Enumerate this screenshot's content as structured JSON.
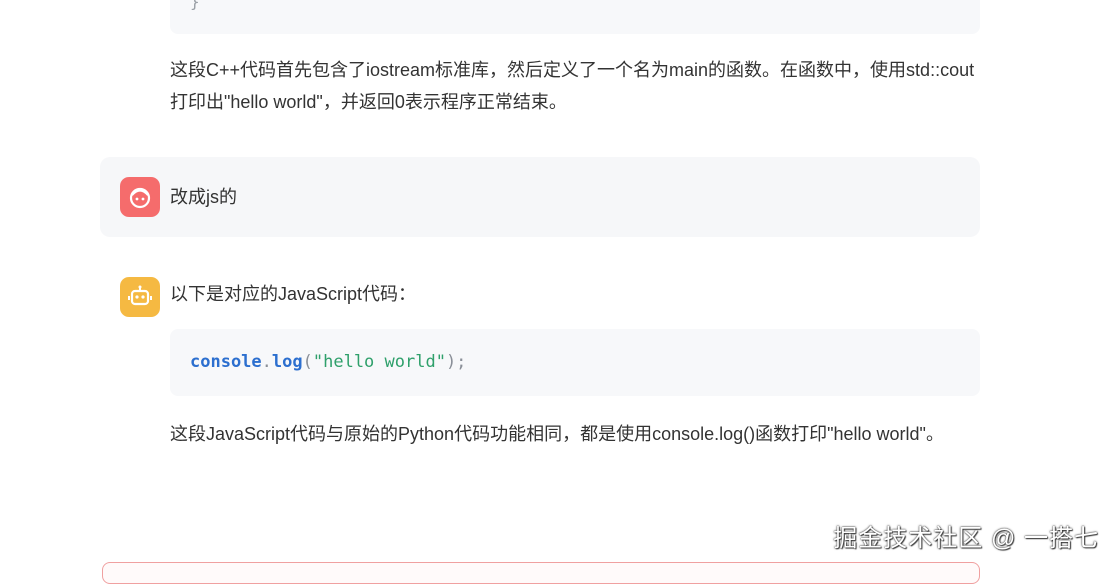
{
  "previous_code": {
    "closing_brace": "}"
  },
  "previous_explanation": "这段C++代码首先包含了iostream标准库，然后定义了一个名为main的函数。在函数中，使用std::cout打印出\"hello world\"，并返回0表示程序正常结束。",
  "user_message": {
    "avatar_icon": "user-face-icon",
    "avatar_color": "#f56c6c",
    "text": "改成js的"
  },
  "bot_message": {
    "avatar_icon": "robot-icon",
    "avatar_color": "#f5b942",
    "intro": "以下是对应的JavaScript代码：",
    "code": {
      "object": "console",
      "dot": ".",
      "method": "log",
      "open_paren": "(",
      "argument": "\"hello world\"",
      "close": ");"
    },
    "explanation": "这段JavaScript代码与原始的Python代码功能相同，都是使用console.log()函数打印\"hello world\"。"
  },
  "watermark": "掘金技术社区 @ 一搭七"
}
